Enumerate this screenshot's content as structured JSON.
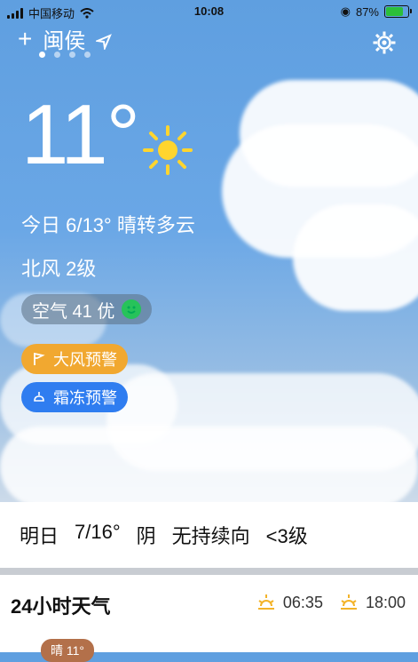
{
  "status_bar": {
    "carrier": "中国移动",
    "time": "10:08",
    "battery_percent": "87%",
    "battery_fill": 0.87
  },
  "topbar": {
    "plus_symbol": "+",
    "city": "闽侯"
  },
  "page_dots": {
    "count": 4,
    "active_index": 0
  },
  "current": {
    "temperature": "11°",
    "summary": "今日 6/13° 晴转多云",
    "wind": "北风 2级",
    "air_quality": "空气 41 优"
  },
  "alerts": [
    {
      "label": "大风预警",
      "color": "#f1a830"
    },
    {
      "label": "霜冻预警",
      "color": "#2f7df0"
    }
  ],
  "tomorrow": {
    "day": "明日",
    "temp_range": "7/16°",
    "condition": "阴",
    "wind_dir": "无持续向",
    "wind_level": "<3级"
  },
  "hourly": {
    "title": "24小时天气",
    "sunrise": "06:35",
    "sunset": "18:00",
    "chip_text": "晴 11°"
  }
}
